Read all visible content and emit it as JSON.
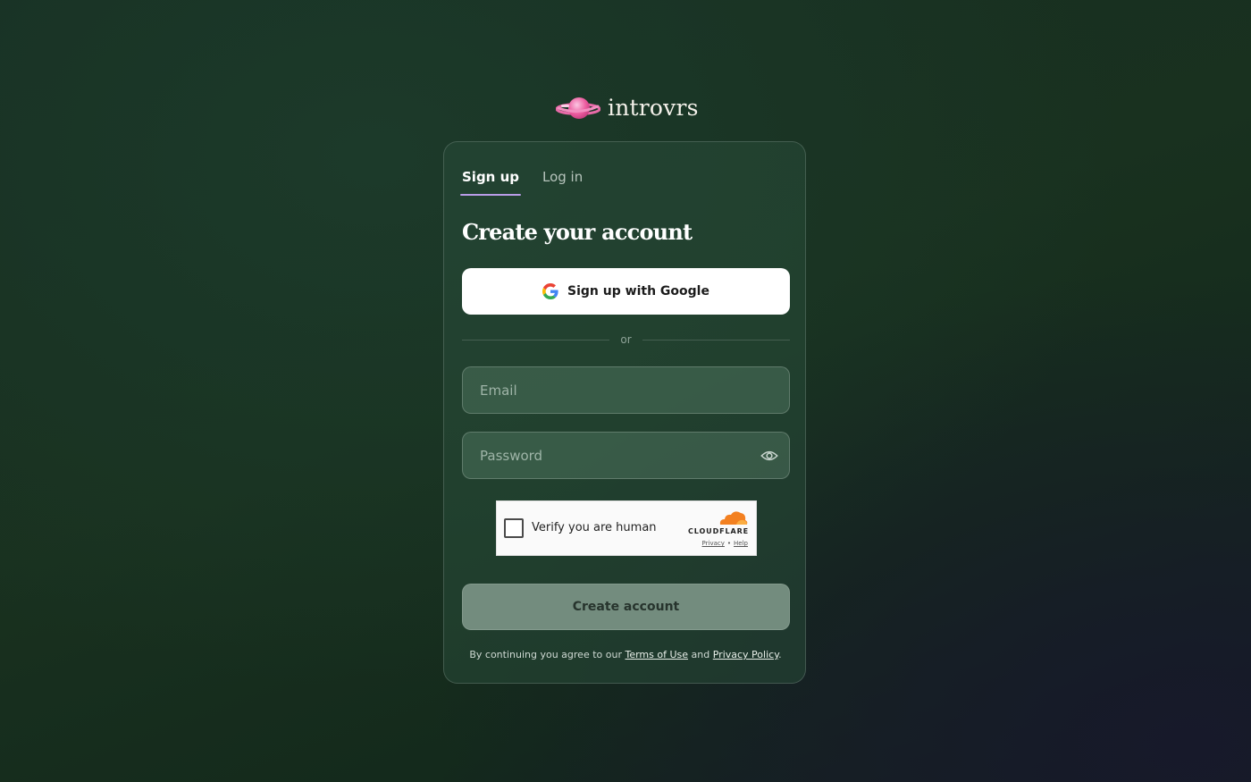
{
  "brand": {
    "name": "introvrs",
    "logo_icon": "planet-icon",
    "logo_colors": [
      "#f05aa0",
      "#f7a6cf"
    ]
  },
  "tabs": [
    {
      "label": "Sign up",
      "active": true
    },
    {
      "label": "Log in",
      "active": false
    }
  ],
  "form": {
    "title": "Create your account",
    "google_button": {
      "label": "Sign up with Google",
      "icon": "google-icon"
    },
    "divider_text": "or",
    "email": {
      "value": "",
      "placeholder": "Email"
    },
    "password": {
      "value": "",
      "placeholder": "Password",
      "toggle_icon": "eye-icon"
    },
    "captcha": {
      "label": "Verify you are human",
      "provider": "CLOUDFLARE",
      "privacy_link": "Privacy",
      "separator": "•",
      "help_link": "Help",
      "checked": false
    },
    "submit": {
      "label": "Create account"
    },
    "legal": {
      "prefix": "By continuing you agree to our",
      "terms": "Terms of Use",
      "conjunction": "and",
      "privacy": "Privacy Policy",
      "suffix": "."
    }
  },
  "colors": {
    "accent_underline": "#b99ce8",
    "card_border": "rgba(255,255,255,0.16)",
    "submit_bg": "#738c7e",
    "cloudflare_orange": "#f38020"
  }
}
